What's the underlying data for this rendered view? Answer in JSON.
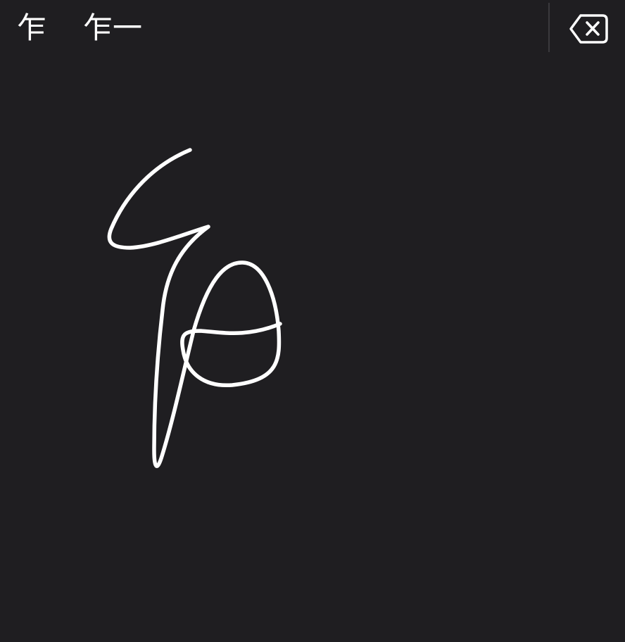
{
  "candidates": {
    "items": [
      {
        "label": "乍"
      },
      {
        "label": "乍一"
      }
    ]
  },
  "toolbar": {
    "delete_icon": "backspace-icon"
  },
  "canvas": {
    "stroke_color": "#ffffff",
    "background_color": "#1f1e21"
  }
}
